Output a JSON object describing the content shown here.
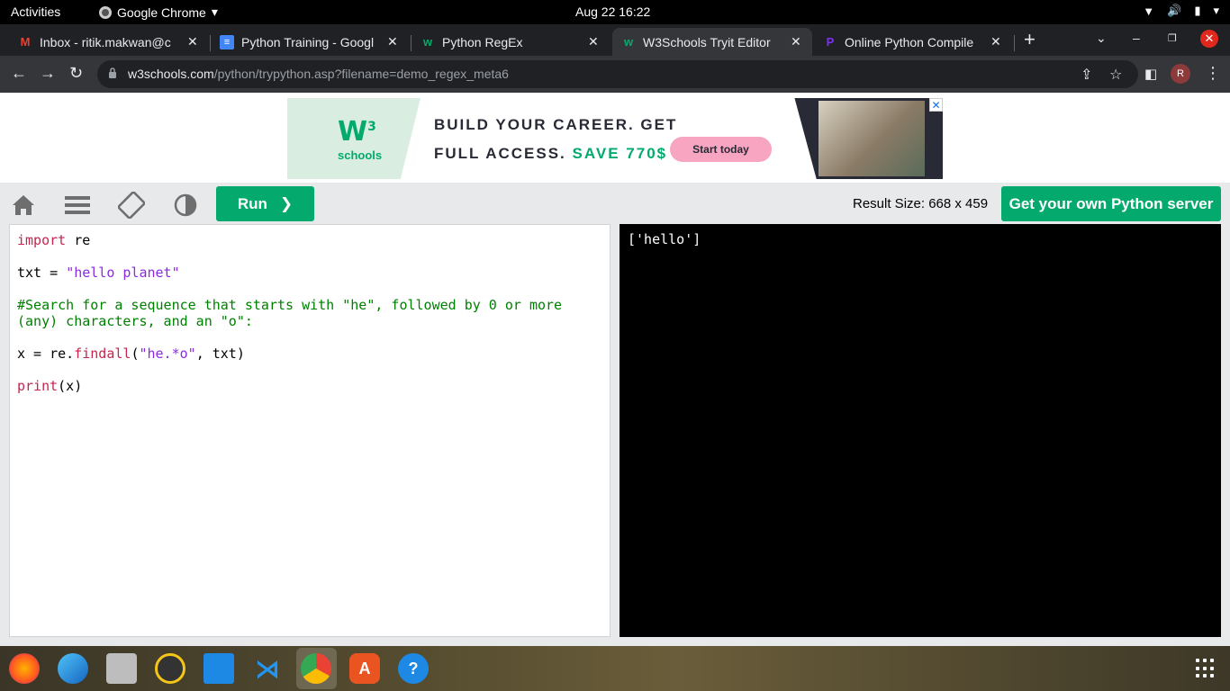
{
  "system": {
    "activities": "Activities",
    "app_name": "Google Chrome",
    "clock": "Aug 22  16:22"
  },
  "tabs": [
    {
      "title": "Inbox - ritik.makwan@c",
      "icon": "gmail-icon"
    },
    {
      "title": "Python Training - Googl",
      "icon": "docs-icon"
    },
    {
      "title": "Python RegEx",
      "icon": "w3schools-icon"
    },
    {
      "title": "W3Schools Tryit Editor",
      "icon": "w3schools-icon",
      "active": true
    },
    {
      "title": "Online Python Compile",
      "icon": "programiz-icon"
    }
  ],
  "address_bar": {
    "host": "w3schools.com",
    "path": "/python/trypython.asp?filename=demo_regex_meta6"
  },
  "profile_initial": "R",
  "ad": {
    "logo_w": "W",
    "logo_sup": "3",
    "logo_schools": "schools",
    "line1": "BUILD YOUR CAREER. GET",
    "line2_prefix": "FULL ACCESS.",
    "line2_save": "SAVE 770$",
    "cta": "Start today",
    "close": "✕"
  },
  "tryit": {
    "run_label": "Run",
    "run_chevron": "❯",
    "result_size": "Result Size: 668 x 459",
    "get_server": "Get your own Python server"
  },
  "code": {
    "line1_kw": "import",
    "line1_rest": " re",
    "line2_var": "txt = ",
    "line2_str": "\"hello planet\"",
    "line3_comment": "#Search for a sequence that starts with \"he\", followed by 0 or more\n(any) characters, and an \"o\":",
    "line4_a": "x = re.",
    "line4_fn": "findall",
    "line4_b": "(",
    "line4_str": "\"he.*o\"",
    "line4_c": ", txt)",
    "line5_fn": "print",
    "line5_rest": "(x)"
  },
  "result_output": "['hello']",
  "colors": {
    "w3_green": "#04aa6d",
    "chrome_dark": "#202124",
    "chrome_toolbar": "#35363a"
  }
}
